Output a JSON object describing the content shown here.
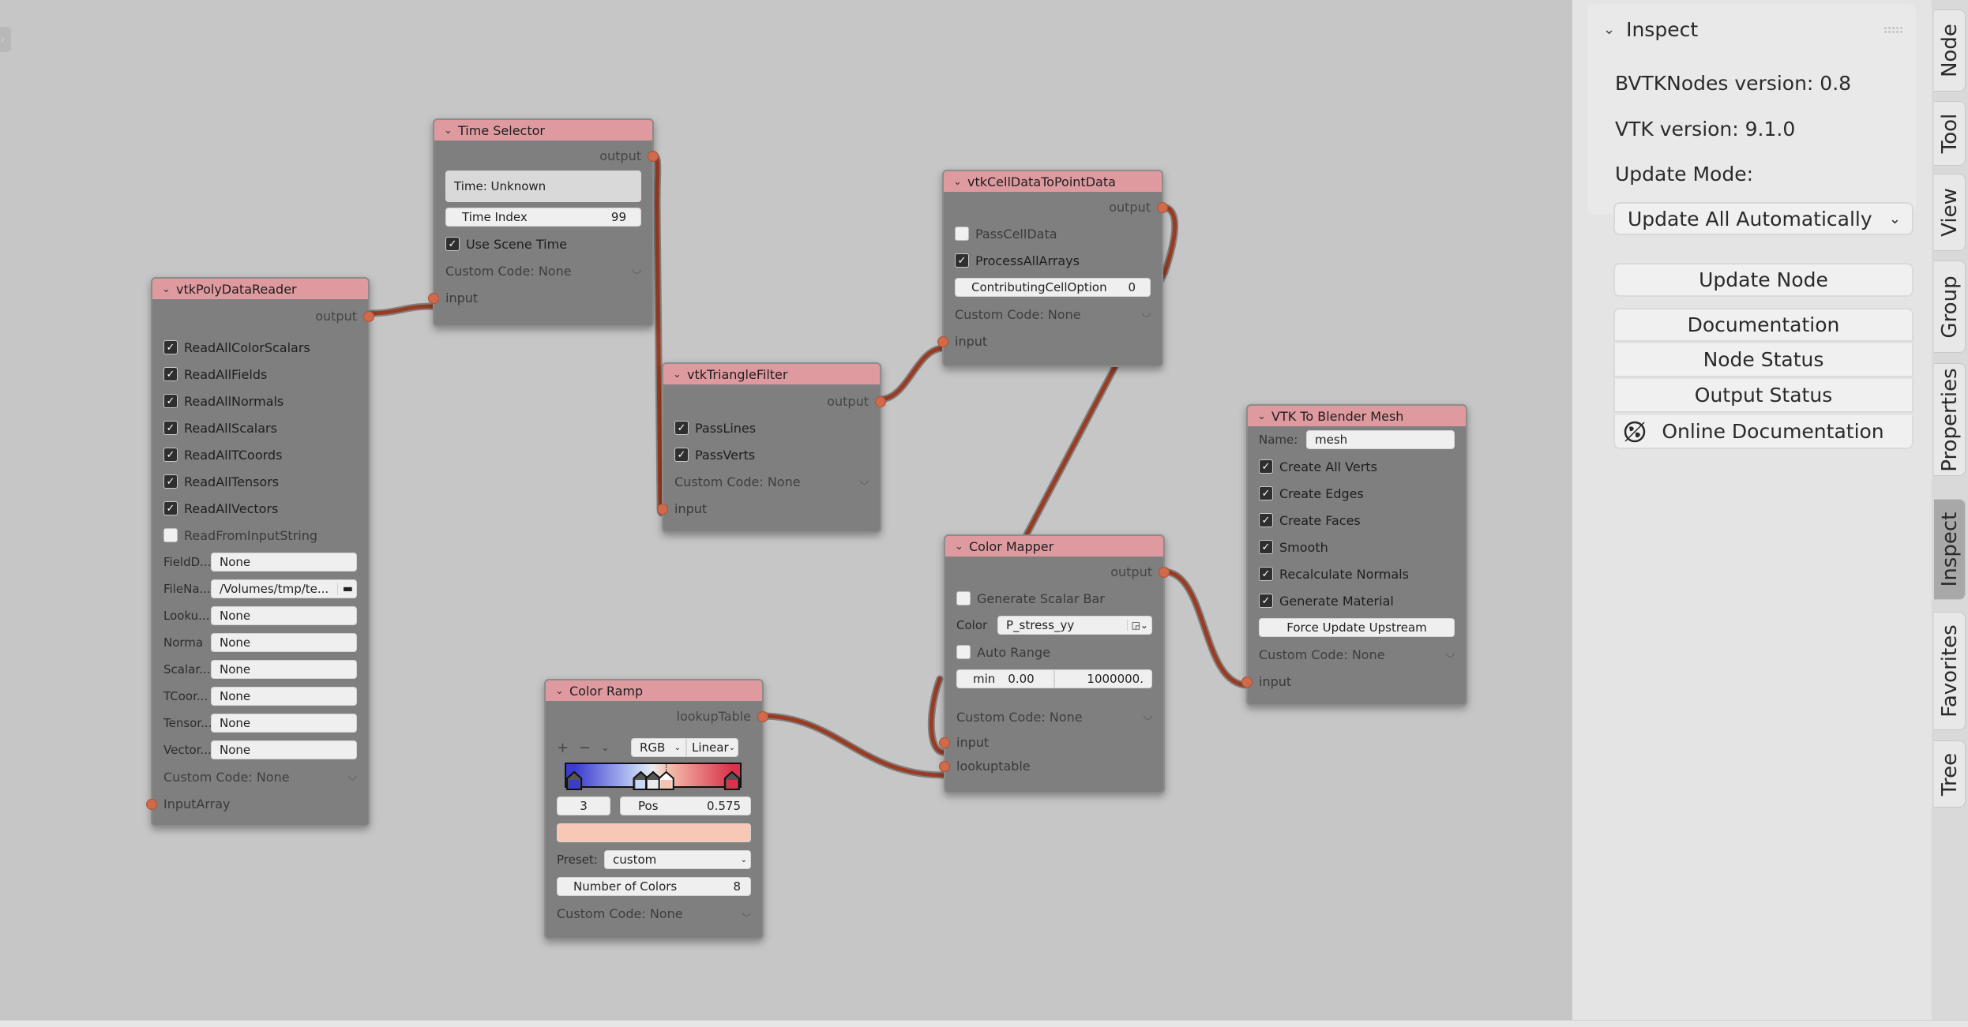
{
  "editor": {
    "sidebar_toggle_icon": "chevron-right-icon",
    "link_color": "#9a3b22",
    "socket_color": "#d06a4a",
    "header_color": "#df9aa0"
  },
  "nodes": {
    "poly_reader": {
      "title": "vtkPolyDataReader",
      "output": "output",
      "checkboxes": [
        {
          "label": "ReadAllColorScalars",
          "checked": true
        },
        {
          "label": "ReadAllFields",
          "checked": true
        },
        {
          "label": "ReadAllNormals",
          "checked": true
        },
        {
          "label": "ReadAllScalars",
          "checked": true
        },
        {
          "label": "ReadAllTCoords",
          "checked": true
        },
        {
          "label": "ReadAllTensors",
          "checked": true
        },
        {
          "label": "ReadAllVectors",
          "checked": true
        },
        {
          "label": "ReadFromInputString",
          "checked": false
        }
      ],
      "fields": [
        {
          "label": "FieldD...",
          "value": "None"
        },
        {
          "label": "FileNa...",
          "value": "/Volumes/tmp/te..."
        },
        {
          "label": "Looku...",
          "value": "None"
        },
        {
          "label": "Norma",
          "value": "None"
        },
        {
          "label": "Scalar...",
          "value": "None"
        },
        {
          "label": "TCoor...",
          "value": "None"
        },
        {
          "label": "Tensor...",
          "value": "None"
        },
        {
          "label": "Vector...",
          "value": "None"
        }
      ],
      "custom_code": "Custom Code: None",
      "input": "InputArray"
    },
    "time_selector": {
      "title": "Time Selector",
      "output": "output",
      "time_label": "Time: Unknown",
      "time_index_label": "Time Index",
      "time_index_value": "99",
      "use_scene_time": "Use Scene Time",
      "use_scene_time_checked": true,
      "custom_code": "Custom Code: None",
      "input": "input"
    },
    "triangle_filter": {
      "title": "vtkTriangleFilter",
      "output": "output",
      "checkboxes": [
        {
          "label": "PassLines",
          "checked": true
        },
        {
          "label": "PassVerts",
          "checked": true
        }
      ],
      "custom_code": "Custom Code: None",
      "input": "input"
    },
    "cell_to_point": {
      "title": "vtkCellDataToPointData",
      "output": "output",
      "checkboxes": [
        {
          "label": "PassCellData",
          "checked": false
        },
        {
          "label": "ProcessAllArrays",
          "checked": true
        }
      ],
      "option_label": "ContributingCellOption",
      "option_value": "0",
      "custom_code": "Custom Code: None",
      "input": "input"
    },
    "color_mapper": {
      "title": "Color Mapper",
      "output": "output",
      "scalar_bar": "Generate Scalar Bar",
      "scalar_bar_checked": false,
      "color_label": "Color",
      "color_value": "P_stress_yy",
      "auto_range": "Auto Range",
      "auto_range_checked": false,
      "min_label": "min",
      "min_value": "0.00",
      "max_value": "1000000.",
      "custom_code": "Custom Code: None",
      "input": "input",
      "lookuptable": "lookuptable"
    },
    "color_ramp": {
      "title": "Color Ramp",
      "output": "lookupTable",
      "plus": "+",
      "minus": "−",
      "color_mode": "RGB",
      "interpolation": "Linear",
      "stops": [
        {
          "pos": 0.05,
          "color": "#3b3bd0"
        },
        {
          "pos": 0.43,
          "color": "#c8d8f5"
        },
        {
          "pos": 0.5,
          "color": "#ececec"
        },
        {
          "pos": 0.575,
          "color": "#f5c3b0"
        },
        {
          "pos": 0.95,
          "color": "#d8334a"
        }
      ],
      "active_index": "3",
      "pos_label": "Pos",
      "pos_value": "0.575",
      "active_color": "#f8c8b6",
      "preset_label": "Preset:",
      "preset_value": "custom",
      "num_colors_label": "Number of Colors",
      "num_colors_value": "8",
      "custom_code": "Custom Code: None"
    },
    "to_mesh": {
      "title": "VTK To Blender Mesh",
      "name_label": "Name:",
      "name_value": "mesh",
      "checkboxes": [
        {
          "label": "Create All Verts",
          "checked": true
        },
        {
          "label": "Create Edges",
          "checked": true
        },
        {
          "label": "Create Faces",
          "checked": true
        },
        {
          "label": "Smooth",
          "checked": true
        },
        {
          "label": "Recalculate Normals",
          "checked": true
        },
        {
          "label": "Generate Material",
          "checked": true
        }
      ],
      "force_update": "Force Update Upstream",
      "custom_code": "Custom Code: None",
      "input": "input"
    }
  },
  "sidebar": {
    "panel_title": "Inspect",
    "bvtk_version": "BVTKNodes version: 0.8",
    "vtk_version": "VTK version: 9.1.0",
    "update_mode_label": "Update Mode:",
    "update_mode_value": "Update All Automatically",
    "update_node": "Update Node",
    "documentation": "Documentation",
    "node_status": "Node Status",
    "output_status": "Output Status",
    "online_documentation": "Online Documentation"
  },
  "tabs": [
    {
      "label": "Node",
      "active": false
    },
    {
      "label": "Tool",
      "active": false
    },
    {
      "label": "View",
      "active": false
    },
    {
      "label": "Group",
      "active": false
    },
    {
      "label": "Properties",
      "active": false
    },
    {
      "label": "Inspect",
      "active": true
    },
    {
      "label": "Favorites",
      "active": false
    },
    {
      "label": "Tree",
      "active": false
    }
  ]
}
